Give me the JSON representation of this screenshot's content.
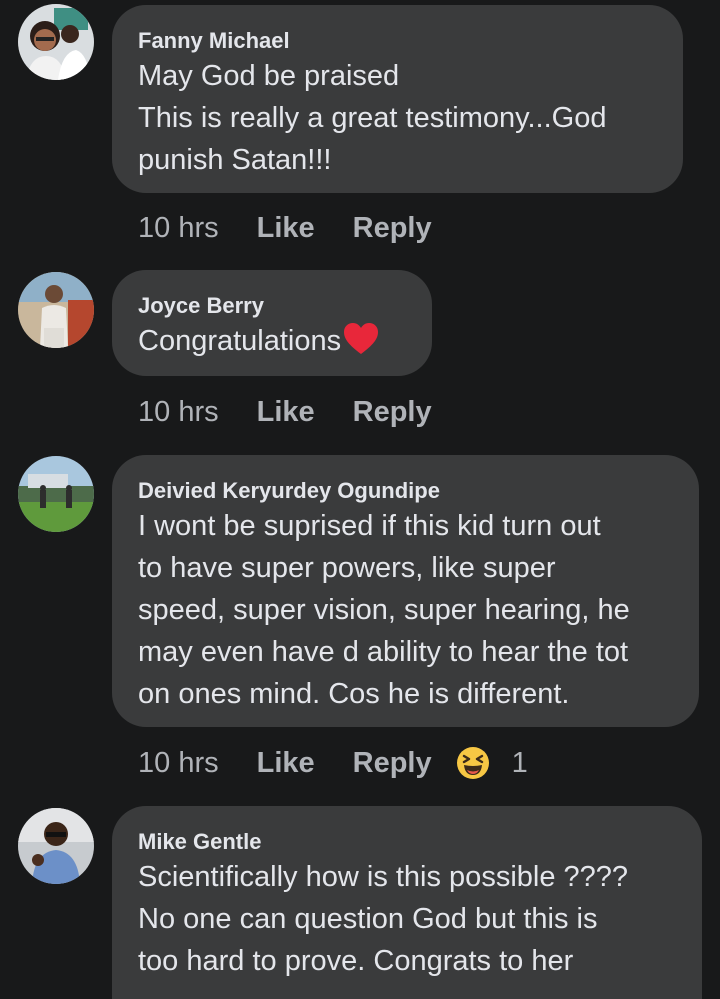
{
  "comments": [
    {
      "author": "Fanny Michael",
      "text": "May God be praised\nThis is really a great testimony...God\npunish Satan!!!",
      "time": "10 hrs",
      "like_label": "Like",
      "reply_label": "Reply"
    },
    {
      "author": "Joyce Berry",
      "text": "Congratulations",
      "emoji": "red-heart-icon",
      "time": "10 hrs",
      "like_label": "Like",
      "reply_label": "Reply"
    },
    {
      "author": "Deivied Keryurdey Ogundipe",
      "text": "I wont be suprised if this kid turn out\nto have super powers, like super\nspeed, super vision,  super hearing, he\nmay even have d ability to hear the tot\non ones mind.  Cos he is different.",
      "time": "10 hrs",
      "like_label": "Like",
      "reply_label": "Reply",
      "reaction_icon": "laughing-emoji-icon",
      "reaction_count": "1"
    },
    {
      "author": "Mike Gentle",
      "text": "Scientifically how is this possible ????\nNo one can question God but this is\ntoo hard to prove. Congrats to her"
    }
  ],
  "colors": {
    "background": "#18191a",
    "bubble": "#3a3b3c",
    "text": "#e4e6eb",
    "secondary_text": "#b0b3b8",
    "heart": "#e8273a",
    "emoji_yellow": "#f7c744"
  }
}
